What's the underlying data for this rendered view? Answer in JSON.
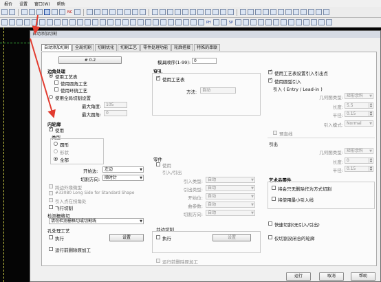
{
  "app": {
    "menu": [
      "报价",
      "设置",
      "窗口(W)",
      "帮助"
    ],
    "toolbar_text": [
      "NC",
      "PH",
      "SP"
    ]
  },
  "dialog": {
    "title": "自动添加切割",
    "tabs": [
      "自动添加切割",
      "全局切割",
      "切割优化",
      "切割工艺",
      "零件处理功能",
      "轮廓搭接",
      "特殊的串联"
    ],
    "active_tab": "自动添加切割",
    "preset_button": "# 0.2",
    "tool_order_label": "模具顺序(1-99):",
    "tool_order_value": "0",
    "edge": {
      "header": "边角处理",
      "use_process_table": "使用工艺表",
      "use_fillet": "使用圆角工艺",
      "use_ring": "使用环绕工艺",
      "use_global": "使用全局切割设置",
      "max_angle_label": "最大角度:",
      "max_angle_value": "105",
      "max_radius_label": "最大圆角:",
      "max_radius_value": "0"
    },
    "inner": {
      "header": "内轮廓",
      "use": "使用",
      "type_label": "类型",
      "type_circle": "圆形",
      "type_shape": "形状",
      "type_all": "全部",
      "start_side_label": "开始边:",
      "start_side_value": "左边",
      "cut_dir_label": "切割方向:",
      "cut_dir_value": "顺时针",
      "cross_micro": "跨边外缘微型",
      "long_side": "#33080 Long Side for Standard Shape",
      "lead_corner": "引入点在拐角处",
      "fly_cut": "飞行切割"
    },
    "detect": {
      "header": "检测栅格切",
      "value": "请勿检测栅格切或切割线"
    },
    "hole": {
      "header": "孔处理工艺",
      "execute": "执行",
      "settings": "设置"
    },
    "pre_delete_left": "运行前删除原加工",
    "pierce": {
      "header": "穿孔",
      "use_process_table": "使用工艺表",
      "method_label": "方法:",
      "method_value": "自动"
    },
    "part": {
      "header": "零件",
      "lines": [
        "使用",
        "引入/引出"
      ],
      "rows": [
        {
          "label": "引入类型:",
          "value": "自动"
        },
        {
          "label": "引出类型:",
          "value": "自动"
        },
        {
          "label": "开始位:",
          "value": "自动"
        },
        {
          "label": "曲参数:",
          "value": "自动"
        },
        {
          "label": "切割方向:",
          "value": "自动"
        }
      ]
    },
    "common": {
      "header": "共边切割",
      "execute": "执行",
      "settings": "设置"
    },
    "pre_delete_mid": "运行前删除原加工",
    "lead": {
      "use_table_outline": "使用工艺表设置引入引出点",
      "use_arc_lead": "使用圆弧引入",
      "header": "引入 ( Entry / Lead-in )",
      "geom_label": "几何图类型:",
      "geom_value": "矩形余料",
      "length_label": "长度:",
      "length_value": "5.5",
      "radius_label": "半径:",
      "radius_value": "0.15",
      "mode_label": "引入模式:",
      "mode_value": "Normal",
      "preview": "预直线"
    },
    "leadout": {
      "header": "引出",
      "geom_label": "几何图类型:",
      "geom_value": "矩形余料",
      "length_label": "长度:",
      "length_value": "0",
      "radius_label": "半径:",
      "radius_value": "0.15"
    },
    "art": {
      "header": "艺术品零件",
      "all_cut": "将会只无删除作为方式切割",
      "min_lead": "将使用最小引入线"
    },
    "fast_cut": "快速切割(无引入/引出)",
    "only_cut_open": "仅切割没闭合的轮廓",
    "buttons": {
      "run": "运行",
      "cancel": "取消",
      "help": "帮助"
    }
  },
  "colors": {
    "accent": "#e23b2f",
    "dialog_bg": "#f0f0f0",
    "canvas": "#050505"
  }
}
